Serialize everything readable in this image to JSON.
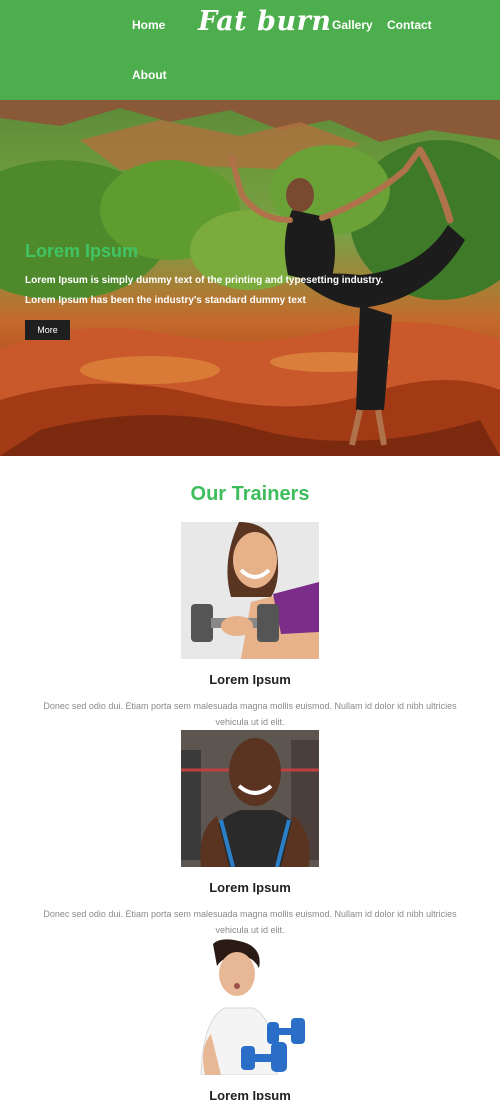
{
  "header": {
    "logo": "Fat burn",
    "nav": {
      "home": "Home",
      "gallery": "Gallery",
      "contact": "Contact",
      "about": "About"
    }
  },
  "hero": {
    "title": "Lorem Ipsum",
    "line1": "Lorem Ipsum is simply dummy text of the printing and typesetting industry.",
    "line2": "Lorem Ipsum has been the industry's standard dummy text",
    "button": "More"
  },
  "trainers": {
    "title": "Our Trainers",
    "items": [
      {
        "name": "Lorem Ipsum",
        "desc": "Donec sed odio dui. Etiam porta sem malesuada magna mollis euismod. Nullam id dolor id nibh ultricies vehicula ut id elit.",
        "photo_icon": "trainer-woman-dumbbell"
      },
      {
        "name": "Lorem Ipsum",
        "desc": "Donec sed odio dui. Etiam porta sem malesuada magna mollis euismod. Nullam id dolor id nibh ultricies vehicula ut id elit.",
        "photo_icon": "trainer-man-gym"
      },
      {
        "name": "Lorem Ipsum",
        "desc": "",
        "photo_icon": "trainer-woman-blue-dumbbells"
      }
    ]
  },
  "colors": {
    "header_bg": "#4cae4c",
    "accent_green": "#3ebd5c",
    "button_bg": "#1f1f1f",
    "body_text": "#8a8a8a"
  }
}
